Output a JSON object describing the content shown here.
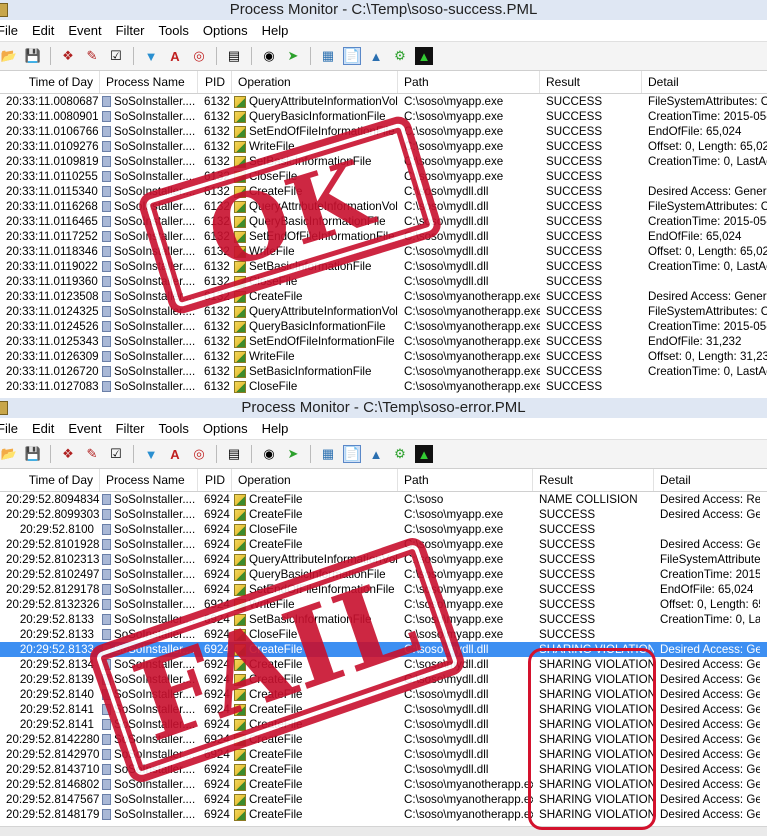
{
  "win1": {
    "title": "Process Monitor - C:\\Temp\\soso-success.PML",
    "menu": [
      "File",
      "Edit",
      "Event",
      "Filter",
      "Tools",
      "Options",
      "Help"
    ],
    "toolbar_icons": [
      "open-icon",
      "save-icon",
      "autoscroll-icon",
      "clear-icon",
      "filter-icon",
      "highlight-icon",
      "target-icon",
      "properties-icon",
      "find-icon",
      "jump-icon",
      "registry-icon",
      "filesystem-icon",
      "network-icon",
      "process-icon",
      "profiling-icon"
    ],
    "headers": {
      "time": "Time of Day",
      "process": "Process Name",
      "pid": "PID",
      "operation": "Operation",
      "path": "Path",
      "result": "Result",
      "detail": "Detail"
    },
    "rows": [
      {
        "time": "20:33:11.0080687",
        "process": "SoSoInstaller....",
        "pid": "6132",
        "operation": "QueryAttributeInformationVolu...",
        "path": "C:\\soso\\myapp.exe",
        "result": "SUCCESS",
        "detail": "FileSystemAttributes: Case"
      },
      {
        "time": "20:33:11.0080901",
        "process": "SoSoInstaller....",
        "pid": "6132",
        "operation": "QueryBasicInformationFile",
        "path": "C:\\soso\\myapp.exe",
        "result": "SUCCESS",
        "detail": "CreationTime: 2015-05-08"
      },
      {
        "time": "20:33:11.0106766",
        "process": "SoSoInstaller....",
        "pid": "6132",
        "operation": "SetEndOfFileInformationFile",
        "path": "C:\\soso\\myapp.exe",
        "result": "SUCCESS",
        "detail": "EndOfFile: 65,024"
      },
      {
        "time": "20:33:11.0109276",
        "process": "SoSoInstaller....",
        "pid": "6132",
        "operation": "WriteFile",
        "path": "C:\\soso\\myapp.exe",
        "result": "SUCCESS",
        "detail": "Offset: 0, Length: 65,024, I"
      },
      {
        "time": "20:33:11.0109819",
        "process": "SoSoInstaller....",
        "pid": "6132",
        "operation": "SetBasicInformationFile",
        "path": "C:\\soso\\myapp.exe",
        "result": "SUCCESS",
        "detail": "CreationTime: 0, LastAcces"
      },
      {
        "time": "20:33:11.0110255",
        "process": "SoSoInstaller....",
        "pid": "6132",
        "operation": "CloseFile",
        "path": "C:\\soso\\myapp.exe",
        "result": "SUCCESS",
        "detail": ""
      },
      {
        "time": "20:33:11.0115340",
        "process": "SoSoInstaller....",
        "pid": "6132",
        "operation": "CreateFile",
        "path": "C:\\soso\\mydll.dll",
        "result": "SUCCESS",
        "detail": "Desired Access: Generic R"
      },
      {
        "time": "20:33:11.0116268",
        "process": "SoSoInstaller....",
        "pid": "6132",
        "operation": "QueryAttributeInformationVolu...",
        "path": "C:\\soso\\mydll.dll",
        "result": "SUCCESS",
        "detail": "FileSystemAttributes: Case"
      },
      {
        "time": "20:33:11.0116465",
        "process": "SoSoInstaller....",
        "pid": "6132",
        "operation": "QueryBasicInformationFile",
        "path": "C:\\soso\\mydll.dll",
        "result": "SUCCESS",
        "detail": "CreationTime: 2015-05-08"
      },
      {
        "time": "20:33:11.0117252",
        "process": "SoSoInstaller....",
        "pid": "6132",
        "operation": "SetEndOfFileInformationFile",
        "path": "C:\\soso\\mydll.dll",
        "result": "SUCCESS",
        "detail": "EndOfFile: 65,024"
      },
      {
        "time": "20:33:11.0118346",
        "process": "SoSoInstaller....",
        "pid": "6132",
        "operation": "WriteFile",
        "path": "C:\\soso\\mydll.dll",
        "result": "SUCCESS",
        "detail": "Offset: 0, Length: 65,024, I"
      },
      {
        "time": "20:33:11.0119022",
        "process": "SoSoInstaller....",
        "pid": "6132",
        "operation": "SetBasicInformationFile",
        "path": "C:\\soso\\mydll.dll",
        "result": "SUCCESS",
        "detail": "CreationTime: 0, LastAcces"
      },
      {
        "time": "20:33:11.0119360",
        "process": "SoSoInstaller....",
        "pid": "6132",
        "operation": "CloseFile",
        "path": "C:\\soso\\mydll.dll",
        "result": "SUCCESS",
        "detail": ""
      },
      {
        "time": "20:33:11.0123508",
        "process": "SoSoInstaller....",
        "pid": "6132",
        "operation": "CreateFile",
        "path": "C:\\soso\\myanotherapp.exe",
        "result": "SUCCESS",
        "detail": "Desired Access: Generic R"
      },
      {
        "time": "20:33:11.0124325",
        "process": "SoSoInstaller....",
        "pid": "6132",
        "operation": "QueryAttributeInformationVolu...",
        "path": "C:\\soso\\myanotherapp.exe",
        "result": "SUCCESS",
        "detail": "FileSystemAttributes: Case"
      },
      {
        "time": "20:33:11.0124526",
        "process": "SoSoInstaller....",
        "pid": "6132",
        "operation": "QueryBasicInformationFile",
        "path": "C:\\soso\\myanotherapp.exe",
        "result": "SUCCESS",
        "detail": "CreationTime: 2015-05-08"
      },
      {
        "time": "20:33:11.0125343",
        "process": "SoSoInstaller....",
        "pid": "6132",
        "operation": "SetEndOfFileInformationFile",
        "path": "C:\\soso\\myanotherapp.exe",
        "result": "SUCCESS",
        "detail": "EndOfFile: 31,232"
      },
      {
        "time": "20:33:11.0126309",
        "process": "SoSoInstaller....",
        "pid": "6132",
        "operation": "WriteFile",
        "path": "C:\\soso\\myanotherapp.exe",
        "result": "SUCCESS",
        "detail": "Offset: 0, Length: 31,232, I"
      },
      {
        "time": "20:33:11.0126720",
        "process": "SoSoInstaller....",
        "pid": "6132",
        "operation": "SetBasicInformationFile",
        "path": "C:\\soso\\myanotherapp.exe",
        "result": "SUCCESS",
        "detail": "CreationTime: 0, LastAcces"
      },
      {
        "time": "20:33:11.0127083",
        "process": "SoSoInstaller....",
        "pid": "6132",
        "operation": "CloseFile",
        "path": "C:\\soso\\myanotherapp.exe",
        "result": "SUCCESS",
        "detail": ""
      }
    ]
  },
  "win2": {
    "title": "Process Monitor - C:\\Temp\\soso-error.PML",
    "menu": [
      "File",
      "Edit",
      "Event",
      "Filter",
      "Tools",
      "Options",
      "Help"
    ],
    "headers": {
      "time": "Time of Day",
      "process": "Process Name",
      "pid": "PID",
      "operation": "Operation",
      "path": "Path",
      "result": "Result",
      "detail": "Detail"
    },
    "rows": [
      {
        "time": "20:29:52.8094834",
        "process": "SoSoInstaller....",
        "pid": "6924",
        "operation": "CreateFile",
        "path": "C:\\soso",
        "result": "NAME COLLISION",
        "detail": "Desired Access: Read"
      },
      {
        "time": "20:29:52.8099303",
        "process": "SoSoInstaller....",
        "pid": "6924",
        "operation": "CreateFile",
        "path": "C:\\soso\\myapp.exe",
        "result": "SUCCESS",
        "detail": "Desired Access: Gener"
      },
      {
        "time": "20:29:52.8100",
        "process": "SoSoInstaller....",
        "pid": "6924",
        "operation": "CloseFile",
        "path": "C:\\soso\\myapp.exe",
        "result": "SUCCESS",
        "detail": ""
      },
      {
        "time": "20:29:52.8101928",
        "process": "SoSoInstaller....",
        "pid": "6924",
        "operation": "CreateFile",
        "path": "C:\\soso\\myapp.exe",
        "result": "SUCCESS",
        "detail": "Desired Access: Gener"
      },
      {
        "time": "20:29:52.8102313",
        "process": "SoSoInstaller....",
        "pid": "6924",
        "operation": "QueryAttributeInformationVolu...",
        "path": "C:\\soso\\myapp.exe",
        "result": "SUCCESS",
        "detail": "FileSystemAttributes: C"
      },
      {
        "time": "20:29:52.8102497",
        "process": "SoSoInstaller....",
        "pid": "6924",
        "operation": "QueryBasicInformationFile",
        "path": "C:\\soso\\myapp.exe",
        "result": "SUCCESS",
        "detail": "CreationTime: 2015-05"
      },
      {
        "time": "20:29:52.8129178",
        "process": "SoSoInstaller....",
        "pid": "6924",
        "operation": "SetEndOfFileInformationFile",
        "path": "C:\\soso\\myapp.exe",
        "result": "SUCCESS",
        "detail": "EndOfFile: 65,024"
      },
      {
        "time": "20:29:52.8132326",
        "process": "SoSoInstaller....",
        "pid": "6924",
        "operation": "WriteFile",
        "path": "C:\\soso\\myapp.exe",
        "result": "SUCCESS",
        "detail": "Offset: 0, Length: 65,0"
      },
      {
        "time": "20:29:52.8133",
        "process": "SoSoInstaller....",
        "pid": "6924",
        "operation": "SetBasicInformationFile",
        "path": "C:\\soso\\myapp.exe",
        "result": "SUCCESS",
        "detail": "CreationTime: 0, LastAc"
      },
      {
        "time": "20:29:52.8133",
        "process": "SoSoInstaller....",
        "pid": "6924",
        "operation": "CloseFile",
        "path": "C:\\soso\\myapp.exe",
        "result": "SUCCESS",
        "detail": ""
      },
      {
        "time": "20:29:52.8133",
        "process": "SoSoInstaller....",
        "pid": "6924",
        "operation": "CreateFile",
        "path": "C:\\soso\\mydll.dll",
        "result": "SHARING VIOLATION",
        "detail": "Desired Access: Gener",
        "selected": true
      },
      {
        "time": "20:29:52.8134",
        "process": "SoSoInstaller....",
        "pid": "6924",
        "operation": "CreateFile",
        "path": "C:\\soso\\mydll.dll",
        "result": "SHARING VIOLATION",
        "detail": "Desired Access: Gener"
      },
      {
        "time": "20:29:52.8139",
        "process": "SoSoInstaller....",
        "pid": "6924",
        "operation": "CreateFile",
        "path": "C:\\soso\\mydll.dll",
        "result": "SHARING VIOLATION",
        "detail": "Desired Access: Gener"
      },
      {
        "time": "20:29:52.8140",
        "process": "SoSoInstaller....",
        "pid": "6924",
        "operation": "CreateFile",
        "path": "C:\\soso\\mydll.dll",
        "result": "SHARING VIOLATION",
        "detail": "Desired Access: Gener"
      },
      {
        "time": "20:29:52.8141",
        "process": "SoSoInstaller....",
        "pid": "6924",
        "operation": "CreateFile",
        "path": "C:\\soso\\mydll.dll",
        "result": "SHARING VIOLATION",
        "detail": "Desired Access: Gener"
      },
      {
        "time": "20:29:52.8141",
        "process": "SoSoInstaller....",
        "pid": "6924",
        "operation": "CreateFile",
        "path": "C:\\soso\\mydll.dll",
        "result": "SHARING VIOLATION",
        "detail": "Desired Access: Gener"
      },
      {
        "time": "20:29:52.8142280",
        "process": "SoSoInstaller....",
        "pid": "6924",
        "operation": "CreateFile",
        "path": "C:\\soso\\mydll.dll",
        "result": "SHARING VIOLATION",
        "detail": "Desired Access: Gener"
      },
      {
        "time": "20:29:52.8142970",
        "process": "SoSoInstaller....",
        "pid": "6924",
        "operation": "CreateFile",
        "path": "C:\\soso\\mydll.dll",
        "result": "SHARING VIOLATION",
        "detail": "Desired Access: Gener"
      },
      {
        "time": "20:29:52.8143710",
        "process": "SoSoInstaller....",
        "pid": "6924",
        "operation": "CreateFile",
        "path": "C:\\soso\\mydll.dll",
        "result": "SHARING VIOLATION",
        "detail": "Desired Access: Gener"
      },
      {
        "time": "20:29:52.8146802",
        "process": "SoSoInstaller....",
        "pid": "6924",
        "operation": "CreateFile",
        "path": "C:\\soso\\myanotherapp.exe",
        "result": "SHARING VIOLATION",
        "detail": "Desired Access: Gener"
      },
      {
        "time": "20:29:52.8147567",
        "process": "SoSoInstaller....",
        "pid": "6924",
        "operation": "CreateFile",
        "path": "C:\\soso\\myanotherapp.exe",
        "result": "SHARING VIOLATION",
        "detail": "Desired Access: Gener"
      },
      {
        "time": "20:29:52.8148179",
        "process": "SoSoInstaller....",
        "pid": "6924",
        "operation": "CreateFile",
        "path": "C:\\soso\\myanotherapp.exe",
        "result": "SHARING VIOLATION",
        "detail": "Desired Access: Gener"
      }
    ]
  },
  "stamps": {
    "ok": "OK",
    "fail": "FAIL"
  },
  "colors": {
    "stamp_red": "#c8102e",
    "selection": "#3d8ff2",
    "highlight_border": "#d3122d"
  }
}
